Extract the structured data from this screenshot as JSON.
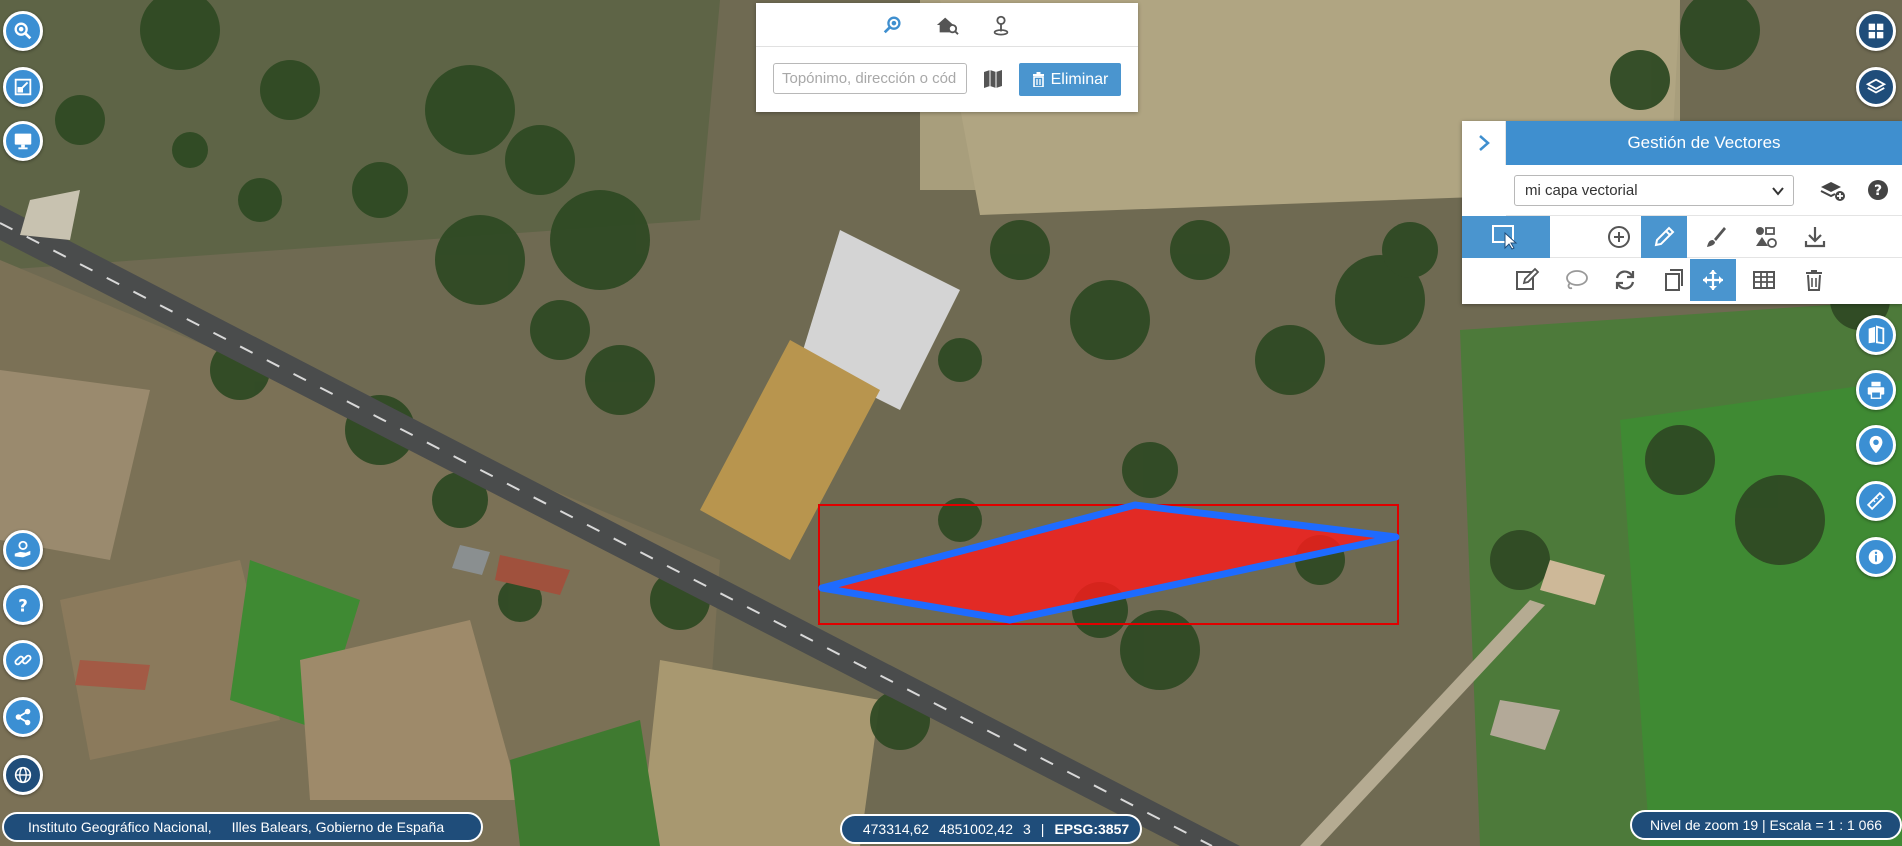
{
  "search": {
    "placeholder": "Topónimo, dirección o cód",
    "delete_label": "Eliminar",
    "tabs": [
      "search-place-icon",
      "search-house-icon",
      "search-location-pin-icon"
    ]
  },
  "vector_panel": {
    "title": "Gestión de Vectores",
    "layer_selected": "mi capa vectorial",
    "toolbar_1": [
      "select-features-icon",
      "add-point-icon",
      "draw-pencil-icon",
      "style-brush-icon",
      "tools-icon",
      "download-icon"
    ],
    "toolbar_2": [
      "edit-icon",
      "lasso-icon",
      "rotate-icon",
      "copy-icon",
      "move-icon",
      "table-icon",
      "trash-icon"
    ],
    "active_tools": [
      "draw-pencil-icon",
      "move-icon"
    ]
  },
  "left_buttons": [
    "zoom-search-icon",
    "extent-icon",
    "fullscreen-monitor-icon",
    "donate-hand-icon",
    "help-icon",
    "link-icon",
    "share-icon",
    "globe-icon"
  ],
  "right_buttons": [
    "apps-grid-icon",
    "layers-icon",
    "map-book-icon",
    "print-icon",
    "location-info-icon",
    "ruler-icon",
    "info-icon"
  ],
  "attribution": {
    "text_1": "Instituto Geográfico Nacional,",
    "text_2": "Illes Balears, Gobierno de España"
  },
  "coordinates": {
    "x": "473314,62",
    "y": "4851002,42",
    "zone": "3",
    "crs": "EPSG:3857"
  },
  "zoom": {
    "text": "Nivel de zoom 19 | Escala = 1 : 1 066"
  },
  "colors": {
    "accent": "#3f8fcf",
    "dark_button": "#1f4d7a",
    "polygon_fill": "#ff1a1a",
    "polygon_stroke": "#1e6bff",
    "bbox_stroke": "#e00000"
  }
}
